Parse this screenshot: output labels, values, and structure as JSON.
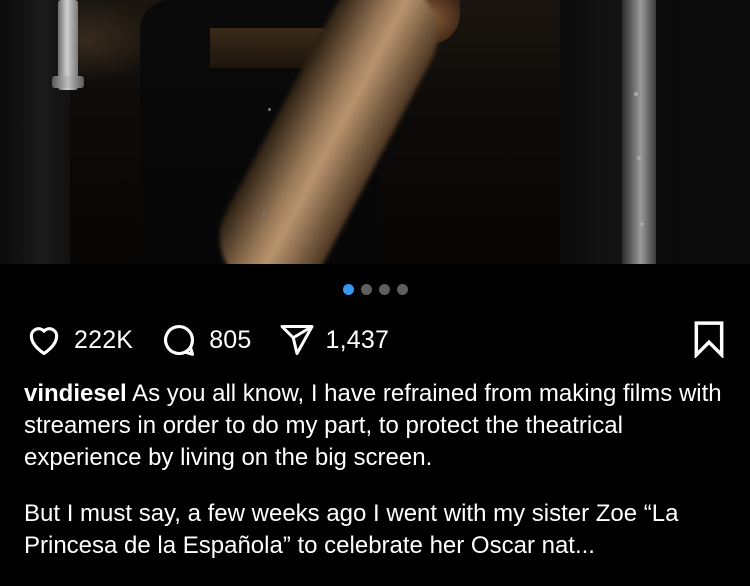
{
  "post": {
    "image": {
      "description_icon": "post-photo",
      "carousel": {
        "total": 4,
        "active_index": 0
      }
    },
    "actions": {
      "like": {
        "icon": "heart-icon",
        "count": "222K"
      },
      "comment": {
        "icon": "comment-icon",
        "count": "805"
      },
      "share": {
        "icon": "send-icon",
        "count": "1,437"
      },
      "save": {
        "icon": "bookmark-icon"
      }
    },
    "caption": {
      "username": "vindiesel",
      "text": "As you all know, I have refrained from making films with streamers in order to do my part, to protect the theatrical experience by living on the big screen.",
      "paragraph2": "But I must say, a few weeks ago I went with my sister Zoe “La Princesa de la Española” to celebrate her Oscar nat..."
    },
    "colors": {
      "accent": "#3897f0",
      "background": "#000000",
      "text": "#ffffff"
    }
  }
}
